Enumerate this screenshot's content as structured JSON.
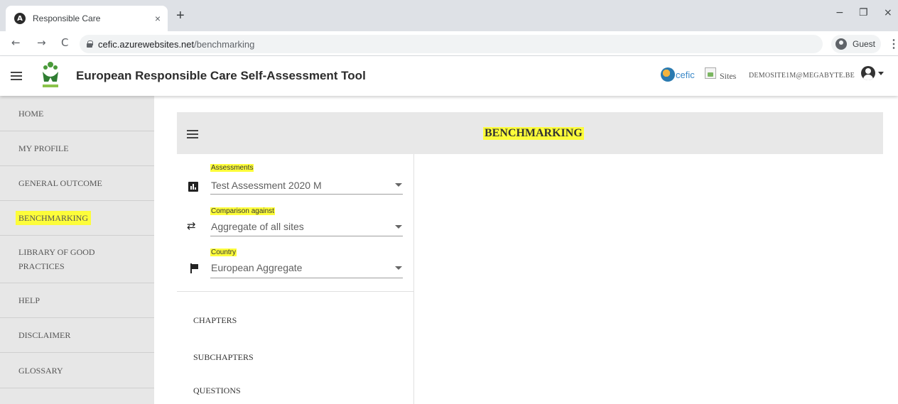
{
  "browser": {
    "tab_title": "Responsible Care",
    "tab_close": "×",
    "new_tab": "+",
    "url_domain": "cefic.azurewebsites.net",
    "url_path": "/benchmarking",
    "profile_label": "Guest",
    "back": "←",
    "forward": "→",
    "reload": "C",
    "minimize": "−",
    "restore": "❐",
    "close": "×",
    "menu": "⋮"
  },
  "header": {
    "title": "European Responsible Care Self-Assessment Tool",
    "partner_logo_text": "cefic",
    "sites_link": "Sites",
    "user_email": "DEMOSITE1M@MEGABYTE.BE"
  },
  "sidebar": {
    "items": [
      {
        "label": "HOME"
      },
      {
        "label": "MY PROFILE"
      },
      {
        "label": "GENERAL OUTCOME"
      },
      {
        "label": "BENCHMARKING",
        "active": true
      },
      {
        "label": "LIBRARY OF GOOD PRACTICES"
      },
      {
        "label": "HELP"
      },
      {
        "label": "DISCLAIMER"
      },
      {
        "label": "GLOSSARY"
      }
    ]
  },
  "page": {
    "title": "BENCHMARKING"
  },
  "filters": {
    "assessments": {
      "label": "Assessments",
      "value": "Test Assessment 2020 M",
      "icon": "bar-chart-icon"
    },
    "comparison": {
      "label": "Comparison against",
      "value": "Aggregate of all sites",
      "icon": "compare-arrows-icon"
    },
    "country": {
      "label": "Country",
      "value": "European Aggregate",
      "icon": "flag-icon"
    }
  },
  "sections": {
    "chapters": "CHAPTERS",
    "subchapters": "SUBCHAPTERS",
    "questions": "QUESTIONS"
  },
  "colors": {
    "highlight": "#fdfd3a",
    "sidebar_bg": "#e7e7e7",
    "panel_header_bg": "#e8e8e8",
    "cefic_blue": "#3a88c8"
  }
}
